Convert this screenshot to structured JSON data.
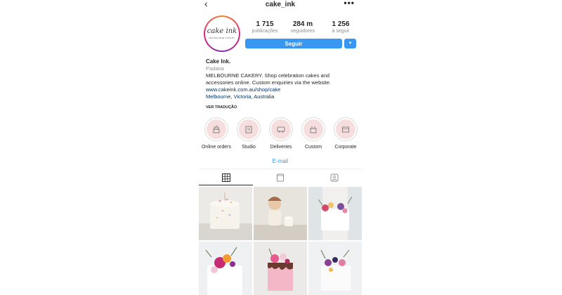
{
  "header": {
    "username": "cake_ink",
    "back_icon": "chevron-left-icon",
    "more_icon": "more-horizontal-icon",
    "more_label": "•••",
    "back_label": "‹"
  },
  "avatar": {
    "logo_text": "cake ink",
    "logo_sub": "MELBOURNE CAKERY"
  },
  "stats": [
    {
      "value": "1 715",
      "label": "publicações"
    },
    {
      "value": "284 m",
      "label": "seguidores"
    },
    {
      "value": "1 256",
      "label": "a seguir"
    }
  ],
  "actions": {
    "follow_label": "Seguir",
    "dropdown_icon": "caret-down-icon",
    "dropdown_label": "▼"
  },
  "bio": {
    "name": "Cake Ink.",
    "category": "Padaria",
    "line1": "MELBOURNE CAKERY. Shop celebration cakes and",
    "line2": "accessories online. Custom enquiries via the website.",
    "link": "www.cakeink.com.au/shop/cake",
    "location": "Melbourne, Victoria, Australia",
    "translate": "VER TRADUÇÃO"
  },
  "highlights": [
    {
      "label": "Online orders",
      "icon": "cake-icon"
    },
    {
      "label": "Studio",
      "icon": "studio-icon"
    },
    {
      "label": "Deliveries",
      "icon": "van-icon"
    },
    {
      "label": "Custom",
      "icon": "custom-cake-icon"
    },
    {
      "label": "Corporate",
      "icon": "box-icon"
    }
  ],
  "contact": {
    "email_label": "E-mail"
  },
  "tabs": [
    {
      "name": "grid",
      "icon": "grid-icon",
      "active": true
    },
    {
      "name": "igtv",
      "icon": "tv-icon",
      "active": false
    },
    {
      "name": "tagged",
      "icon": "tagged-icon",
      "active": false
    }
  ],
  "colors": {
    "primary": "#3897f0",
    "text": "#262626",
    "muted": "#8e8e8e",
    "highlight_bg": "#f7dede",
    "link": "#003569"
  }
}
